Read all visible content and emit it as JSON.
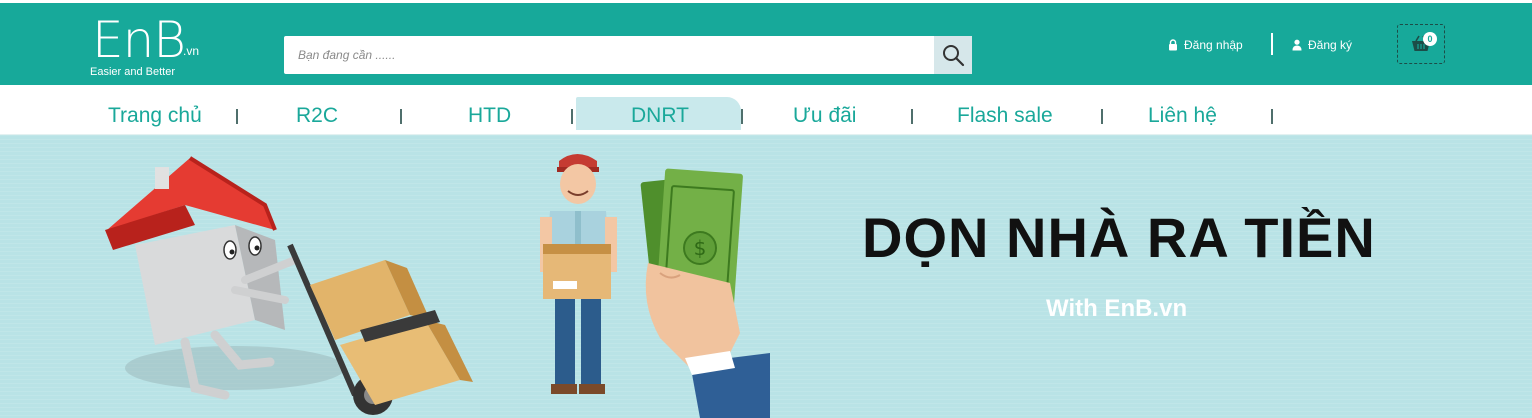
{
  "brand": {
    "logo_main": "EnB",
    "logo_suffix": ".vn",
    "tagline": "Easier and Better",
    "color": "#17a99a"
  },
  "search": {
    "placeholder": "Bạn đang cần ......",
    "icon": "search-icon"
  },
  "auth": {
    "login_label": "Đăng nhập",
    "login_icon": "lock-icon",
    "register_label": "Đăng ký",
    "register_icon": "user-icon"
  },
  "cart": {
    "icon": "basket-icon",
    "count": "0"
  },
  "nav": {
    "items": [
      {
        "label": "Trang chủ",
        "active": false
      },
      {
        "label": "R2C",
        "active": false
      },
      {
        "label": "HTD",
        "active": false
      },
      {
        "label": "DNRT",
        "active": true
      },
      {
        "label": "Ưu đãi",
        "active": false
      },
      {
        "label": "Flash sale",
        "active": false
      },
      {
        "label": "Liên hệ",
        "active": false
      }
    ],
    "active_bg": "#c9e9ec",
    "text_color": "#1aa89a"
  },
  "banner": {
    "title": "DỌN NHÀ RA TIỀN",
    "subtitle": "With EnB.vn",
    "background": "#b9e3e6"
  }
}
